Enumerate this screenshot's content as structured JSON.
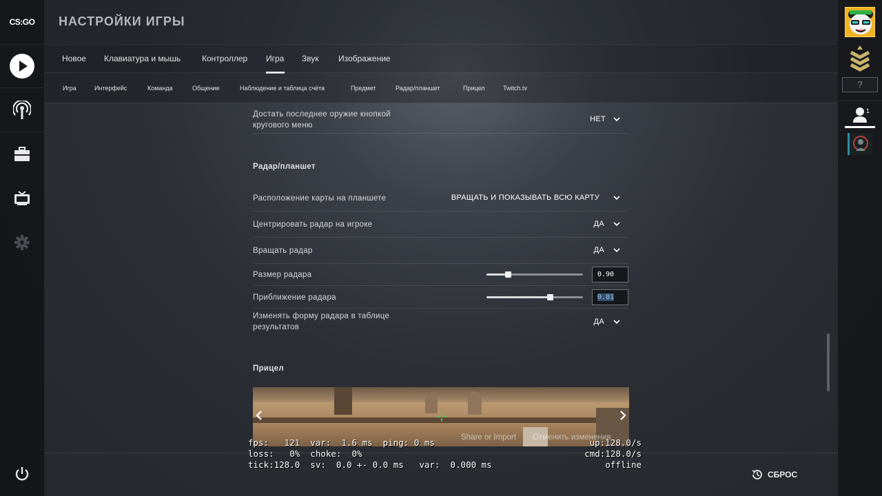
{
  "app": {
    "logo_text": "CS:GO"
  },
  "header": {
    "title": "НАСТРОЙКИ ИГРЫ"
  },
  "left_rail": {
    "items": [
      {
        "name": "play",
        "icon": "play-icon"
      },
      {
        "name": "watch",
        "icon": "broadcast-icon"
      },
      {
        "name": "inventory",
        "icon": "briefcase-icon"
      },
      {
        "name": "tv",
        "icon": "tv-icon"
      },
      {
        "name": "settings",
        "icon": "gear-icon"
      },
      {
        "name": "power",
        "icon": "power-icon"
      }
    ]
  },
  "main_tabs": [
    {
      "label": "Новое"
    },
    {
      "label": "Клавиатура и мышь"
    },
    {
      "label": "Контроллер"
    },
    {
      "label": "Игра",
      "active": true
    },
    {
      "label": "Звук"
    },
    {
      "label": "Изображение"
    }
  ],
  "sub_tabs": [
    {
      "label": "Игра"
    },
    {
      "label": "Интерфейс"
    },
    {
      "label": "Команда"
    },
    {
      "label": "Общение"
    },
    {
      "label": "Наблюдение и таблица счёта"
    },
    {
      "label": "Предмет"
    },
    {
      "label": "Радар/планшет"
    },
    {
      "label": "Прицел"
    },
    {
      "label": "Twitch.tv"
    }
  ],
  "settings": {
    "last_weapon": {
      "label_line1": "Достать последнее оружие кнопкой",
      "label_line2": "кругового меню",
      "value": "НЕТ"
    },
    "radar_section_title": "Радар/планшет",
    "map_orientation": {
      "label": "Расположение карты на планшете",
      "value": "ВРАЩАТЬ И ПОКАЗЫВАТЬ ВСЮ КАРТУ"
    },
    "center_radar": {
      "label": "Центрировать радар на игроке",
      "value": "ДА"
    },
    "rotate_radar": {
      "label": "Вращать радар",
      "value": "ДА"
    },
    "radar_size": {
      "label": "Размер радара",
      "value": "0.90",
      "slider_fraction": 0.22
    },
    "radar_zoom": {
      "label": "Приближение радара",
      "value": "0.81",
      "slider_fraction": 0.66
    },
    "radar_shape": {
      "label_line1": "Изменять форму радара в таблице",
      "label_line2": "результатов",
      "value": "ДА"
    },
    "crosshair_section_title": "Прицел"
  },
  "preview": {
    "share_label": "Share or Import",
    "cancel_label": "Отменить изменения"
  },
  "netgraph": {
    "line1": "fps:   121  var:  1.6 ms  ping: 0 ms",
    "line2": "loss:   0%  choke:  0%",
    "line3": "tick:128.0  sv:  0.0 +- 0.0 ms   var:  0.000 ms",
    "right1": "up:128.0/s",
    "right2": "cmd:128.0/s",
    "right3": "offline"
  },
  "footer": {
    "reset_label": "СБРОС"
  },
  "right_rail": {
    "unknown_rank": "?",
    "friends_count": "1"
  },
  "colors": {
    "accent": "#ffffff",
    "avatar_bg": "#f0b322",
    "selection": "#33506e"
  }
}
